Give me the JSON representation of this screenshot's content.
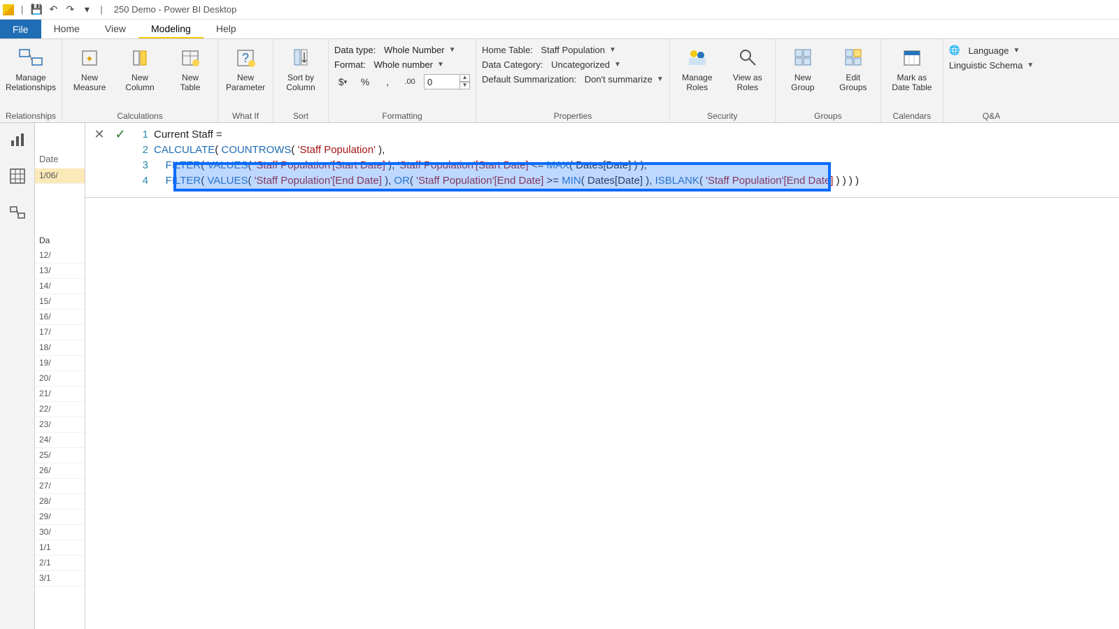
{
  "title": "250 Demo - Power BI Desktop",
  "qat": {
    "save": "💾",
    "undo": "↶",
    "redo": "↷",
    "dd": "▾"
  },
  "tabs": {
    "file": "File",
    "home": "Home",
    "view": "View",
    "modeling": "Modeling",
    "help": "Help",
    "active": "Modeling"
  },
  "ribbon": {
    "relationships": {
      "manage": "Manage\nRelationships",
      "group": "Relationships"
    },
    "calculations": {
      "measure": "New\nMeasure",
      "column": "New\nColumn",
      "table": "New\nTable",
      "group": "Calculations"
    },
    "whatif": {
      "param": "New\nParameter",
      "group": "What If"
    },
    "sort": {
      "sortby": "Sort by\nColumn",
      "group": "Sort"
    },
    "formatting": {
      "datatype_lbl": "Data type:",
      "datatype_val": "Whole Number",
      "format_lbl": "Format:",
      "format_val": "Whole number",
      "currency": "$",
      "percent": "%",
      "comma": ",",
      "decimals_icon": ".00",
      "decimals_val": "0",
      "group": "Formatting"
    },
    "properties": {
      "hometable_lbl": "Home Table:",
      "hometable_val": "Staff Population",
      "datacat_lbl": "Data Category:",
      "datacat_val": "Uncategorized",
      "summ_lbl": "Default Summarization:",
      "summ_val": "Don't summarize",
      "group": "Properties"
    },
    "security": {
      "manage": "Manage\nRoles",
      "viewas": "View as\nRoles",
      "group": "Security"
    },
    "groups": {
      "new": "New\nGroup",
      "edit": "Edit\nGroups",
      "group": "Groups"
    },
    "calendars": {
      "mark": "Mark as\nDate Table",
      "group": "Calendars"
    },
    "qna": {
      "lang": "Language",
      "schema": "Linguistic Schema",
      "group": "Q&A"
    }
  },
  "formula_controls": {
    "cancel": "✕",
    "commit": "✓"
  },
  "formula": {
    "line1_plain": "Current Staff =",
    "line2": {
      "calc": "CALCULATE",
      "count": "COUNTROWS",
      "table": "'Staff Population'",
      "tail": " ),"
    },
    "line3": {
      "filter": "FILTER",
      "values": "VALUES",
      "col": "'Staff Population'[Start Date]",
      "mid": " ), ",
      "col2": "'Staff Population'[Start Date]",
      "op": " <= ",
      "max": "MAX",
      "dates": "Dates[Date]",
      "tail": " ) ),"
    },
    "line4": {
      "filter": "FILTER",
      "values": "VALUES",
      "col": "'Staff Population'[End Date]",
      "mid": " ), ",
      "or": "OR",
      "col2": "'Staff Population'[End Date]",
      "op": " >= ",
      "min": "MIN",
      "dates": "Dates[Date]",
      "sep": " ), ",
      "isblank": "ISBLANK",
      "col3": "'Staff Population'[End Date]",
      "tail": " ) ) ) )"
    }
  },
  "behind": {
    "date_label": "Date",
    "first_cell": "1/06/",
    "col_header": "Da"
  },
  "gutter_rows": [
    "12/",
    "13/",
    "14/",
    "15/",
    "16/",
    "17/",
    "18/",
    "19/",
    "20/",
    "21/",
    "22/",
    "23/",
    "24/",
    "25/",
    "26/",
    "27/",
    "28/",
    "29/",
    "30/",
    "1/1",
    "2/1",
    "3/1"
  ]
}
